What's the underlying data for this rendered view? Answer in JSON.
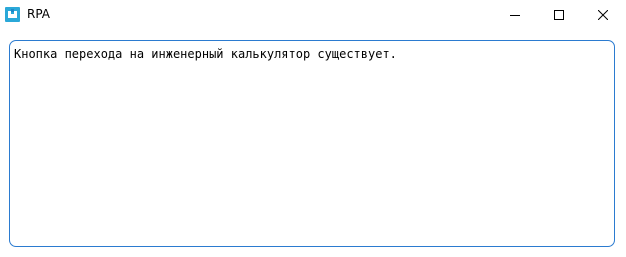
{
  "window": {
    "title": "RPA",
    "icon": "rpa-app-icon",
    "controls": {
      "minimize_icon": "minimize-icon",
      "maximize_icon": "maximize-icon",
      "close_icon": "close-icon"
    }
  },
  "content": {
    "message": "Кнопка перехода на инженерный калькулятор существует."
  },
  "colors": {
    "accent_border": "#2b7bd0",
    "icon_primary": "#2aa8d8",
    "icon_secondary": "#1e88c9"
  }
}
